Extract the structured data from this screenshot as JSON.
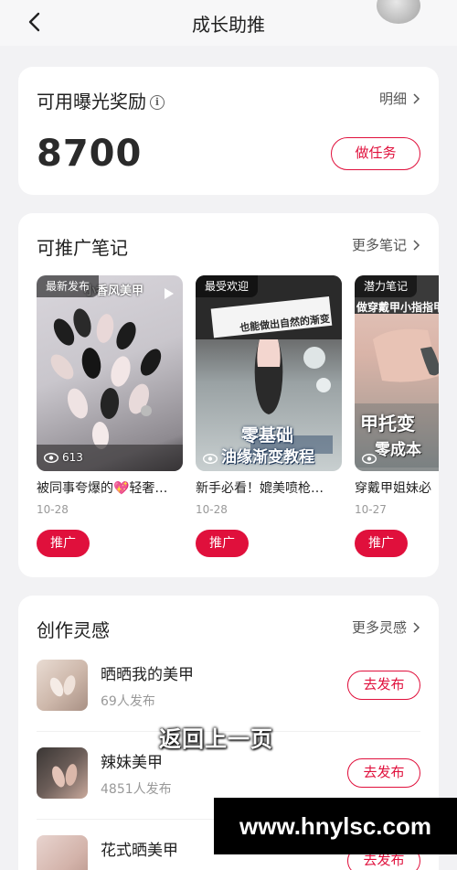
{
  "header": {
    "title": "成长助推"
  },
  "reward": {
    "title": "可用曝光奖励",
    "info_icon": "info-icon",
    "detail_label": "明细",
    "amount": "8700",
    "task_button": "做任务",
    "accent_color": "#e0103c"
  },
  "notes": {
    "title": "可推广笔记",
    "more_label": "更多笔记",
    "items": [
      {
        "badge": "最新发布",
        "views": "613",
        "title": "被同事夸爆的💖轻奢…",
        "date": "10-28",
        "button": "推广"
      },
      {
        "badge": "最受欢迎",
        "views": "",
        "title": "新手必看！媲美喷枪…",
        "date": "10-28",
        "button": "推广"
      },
      {
        "badge": "潜力笔记",
        "views": "",
        "title": "穿戴甲姐妹必",
        "date": "10-27",
        "button": "推广"
      }
    ]
  },
  "inspiration": {
    "title": "创作灵感",
    "more_label": "更多灵感",
    "items": [
      {
        "name": "晒晒我的美甲",
        "count": "69人发布",
        "button": "去发布"
      },
      {
        "name": "辣妹美甲",
        "count": "4851人发布",
        "button": "去发布"
      },
      {
        "name": "花式晒美甲",
        "count": "",
        "button": "去发布"
      }
    ]
  },
  "toast": {
    "text": "返回上一页"
  },
  "watermark": {
    "text": "www.hnylsc.com"
  }
}
